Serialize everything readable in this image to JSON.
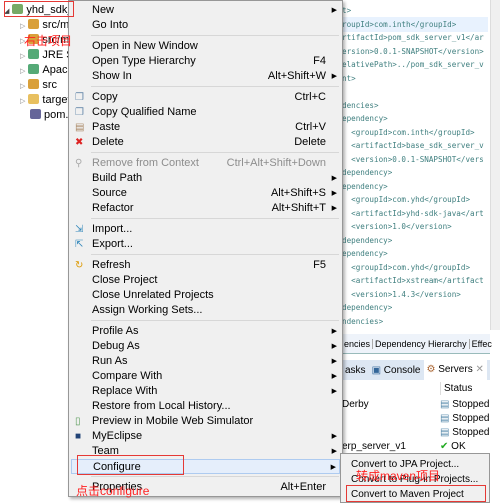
{
  "tree": {
    "items": [
      {
        "label": "yhd_sdk_",
        "icon": "project-icon"
      },
      {
        "label": "src/m",
        "icon": "package-folder-icon"
      },
      {
        "label": "src/m",
        "icon": "package-folder-icon"
      },
      {
        "label": "JRE Sy",
        "icon": "library-icon"
      },
      {
        "label": "Apach",
        "icon": "library-icon"
      },
      {
        "label": "src",
        "icon": "source-folder-icon"
      },
      {
        "label": "target",
        "icon": "folder-icon"
      },
      {
        "label": "pom.x",
        "icon": "maven-file-icon"
      }
    ]
  },
  "editor": {
    "lines": [
      "t>",
      "roupId>com.inth</groupId>",
      "rtifactId>pom_sdk_server_v1</ar",
      "ersion>0.0.1-SNAPSHOT</version>",
      "elativePath>../pom_sdk_server_v",
      "nt>",
      "",
      "dencies>",
      "ependency>",
      "  <groupId>com.inth</groupId>",
      "  <artifactId>base_sdk_server_v",
      "  <version>0.0.1-SNAPSHOT</vers",
      "dependency>",
      "ependency>",
      "  <groupId>com.yhd</groupId>",
      "  <artifactId>yhd-sdk-java</art",
      "  <version>1.0</version>",
      "dependency>",
      "ependency>",
      "  <groupId>com.yhd</groupId>",
      "  <artifactId>xstream</artifact",
      "  <version>1.4.3</version>",
      "dependency>",
      "ndencies>"
    ]
  },
  "editor_tabs": [
    "encies",
    "Dependency Hierarchy",
    "Effec"
  ],
  "view_tabs": [
    "asks",
    "Console",
    "Servers"
  ],
  "servers": {
    "status_header": "Status",
    "rows": [
      {
        "name": "Derby",
        "status": "Stopped"
      },
      {
        "name": "",
        "status": "Stopped"
      },
      {
        "name": "",
        "status": "Stopped"
      },
      {
        "name": "erp_server_v1",
        "status": "OK"
      }
    ]
  },
  "menu": {
    "groups": [
      [
        {
          "label": "New",
          "sub": true
        },
        {
          "label": "Go Into"
        }
      ],
      [
        {
          "label": "Open in New Window"
        },
        {
          "label": "Open Type Hierarchy",
          "shortcut": "F4"
        },
        {
          "label": "Show In",
          "shortcut": "Alt+Shift+W",
          "sub": true
        }
      ],
      [
        {
          "label": "Copy",
          "shortcut": "Ctrl+C",
          "icon": "copy-icon"
        },
        {
          "label": "Copy Qualified Name",
          "icon": "copy-qualified-icon"
        },
        {
          "label": "Paste",
          "shortcut": "Ctrl+V",
          "icon": "paste-icon"
        },
        {
          "label": "Delete",
          "shortcut": "Delete",
          "icon": "delete-icon"
        }
      ],
      [
        {
          "label": "Remove from Context",
          "shortcut": "Ctrl+Alt+Shift+Down",
          "disabled": true,
          "icon": "remove-context-icon"
        },
        {
          "label": "Build Path",
          "sub": true
        },
        {
          "label": "Source",
          "shortcut": "Alt+Shift+S",
          "sub": true
        },
        {
          "label": "Refactor",
          "shortcut": "Alt+Shift+T",
          "sub": true
        }
      ],
      [
        {
          "label": "Import...",
          "icon": "import-icon"
        },
        {
          "label": "Export...",
          "icon": "export-icon"
        }
      ],
      [
        {
          "label": "Refresh",
          "shortcut": "F5",
          "icon": "refresh-icon"
        },
        {
          "label": "Close Project"
        },
        {
          "label": "Close Unrelated Projects"
        },
        {
          "label": "Assign Working Sets..."
        }
      ],
      [
        {
          "label": "Profile As",
          "sub": true
        },
        {
          "label": "Debug As",
          "sub": true
        },
        {
          "label": "Run As",
          "sub": true
        },
        {
          "label": "Compare With",
          "sub": true
        },
        {
          "label": "Replace With",
          "sub": true
        },
        {
          "label": "Restore from Local History..."
        },
        {
          "label": "Preview in Mobile Web Simulator",
          "icon": "mobile-icon"
        },
        {
          "label": "MyEclipse",
          "sub": true,
          "icon": "myeclipse-icon"
        },
        {
          "label": "Team",
          "sub": true
        },
        {
          "label": "Configure",
          "sub": true,
          "selected": true
        }
      ],
      [
        {
          "label": "Properties",
          "shortcut": "Alt+Enter"
        }
      ]
    ]
  },
  "submenu": {
    "items": [
      "Convert to JPA Project...",
      "Convert to Plug-in Projects...",
      "Convert to Maven Project"
    ]
  },
  "annotations": {
    "right_click": "右击项目",
    "click_configure": "点击configure",
    "convert_maven": "转成maven项目"
  },
  "colors": {
    "annotation": "#ff2222",
    "selection": "#e5eefb"
  }
}
